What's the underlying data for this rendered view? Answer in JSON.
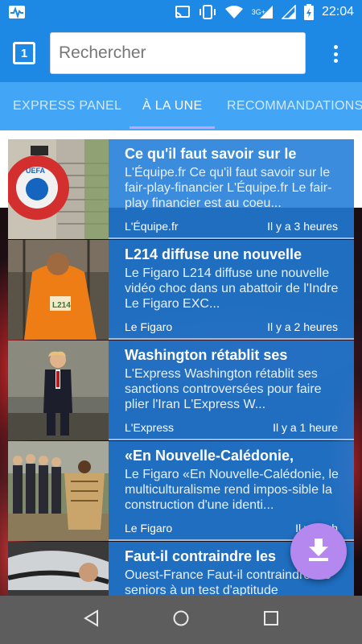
{
  "status_bar": {
    "time": "22:04",
    "network_label": "3G+",
    "icons": [
      "activity-icon",
      "cast-icon",
      "vibrate-icon",
      "wifi-icon",
      "signal-icon",
      "signal-icon",
      "battery-charging-icon"
    ]
  },
  "app_bar": {
    "tab_count": "1",
    "search_placeholder": "Rechercher",
    "search_value": ""
  },
  "tabs": [
    {
      "label": "EXPRESS PANEL",
      "active": false
    },
    {
      "label": "À LA UNE",
      "active": true
    },
    {
      "label": "RECOMMANDATIONS",
      "active": false
    }
  ],
  "articles": [
    {
      "title": "Ce qu'il faut savoir sur le",
      "description": "L'Équipe.fr Ce qu'il faut savoir sur le fair-play-financier L'Équipe.fr Le fair-play financier est au coeu...",
      "source": "L'Équipe.fr",
      "time": "Il y a 3 heures"
    },
    {
      "title": "L214 diffuse une nouvelle",
      "description": "Le Figaro L214 diffuse une nouvelle vidéo choc dans un abattoir de l'Indre Le Figaro EXC...",
      "source": "Le Figaro",
      "time": "Il y a 2 heures"
    },
    {
      "title": "Washington rétablit ses",
      "description": "L'Express Washington rétablit ses sanctions controversées pour faire plier l'Iran L'Express W...",
      "source": "L'Express",
      "time": "Il y a 1 heure"
    },
    {
      "title": "«En Nouvelle-Calédonie,",
      "description": "Le Figaro «En Nouvelle-Calédonie, le multiculturalisme rend impos-sible la construction d'une identi...",
      "source": "Le Figaro",
      "time": "Il y a 2 h"
    },
    {
      "title": "Faut-il contraindre les",
      "description": "Ouest-France Faut-il contraindre les seniors à un test d'aptitude",
      "source": "",
      "time": ""
    }
  ],
  "colors": {
    "primary": "#1e88e5",
    "tabs_bg": "#42a5f5",
    "card_bg": "#217cd8",
    "fab": "#b588f0",
    "tab_indicator": "#c6a3f5",
    "nav_bar": "#5d5d5d"
  },
  "fab": {
    "icon": "download-icon"
  },
  "nav_bar": {
    "icons": [
      "back-icon",
      "home-icon",
      "recents-icon"
    ]
  }
}
